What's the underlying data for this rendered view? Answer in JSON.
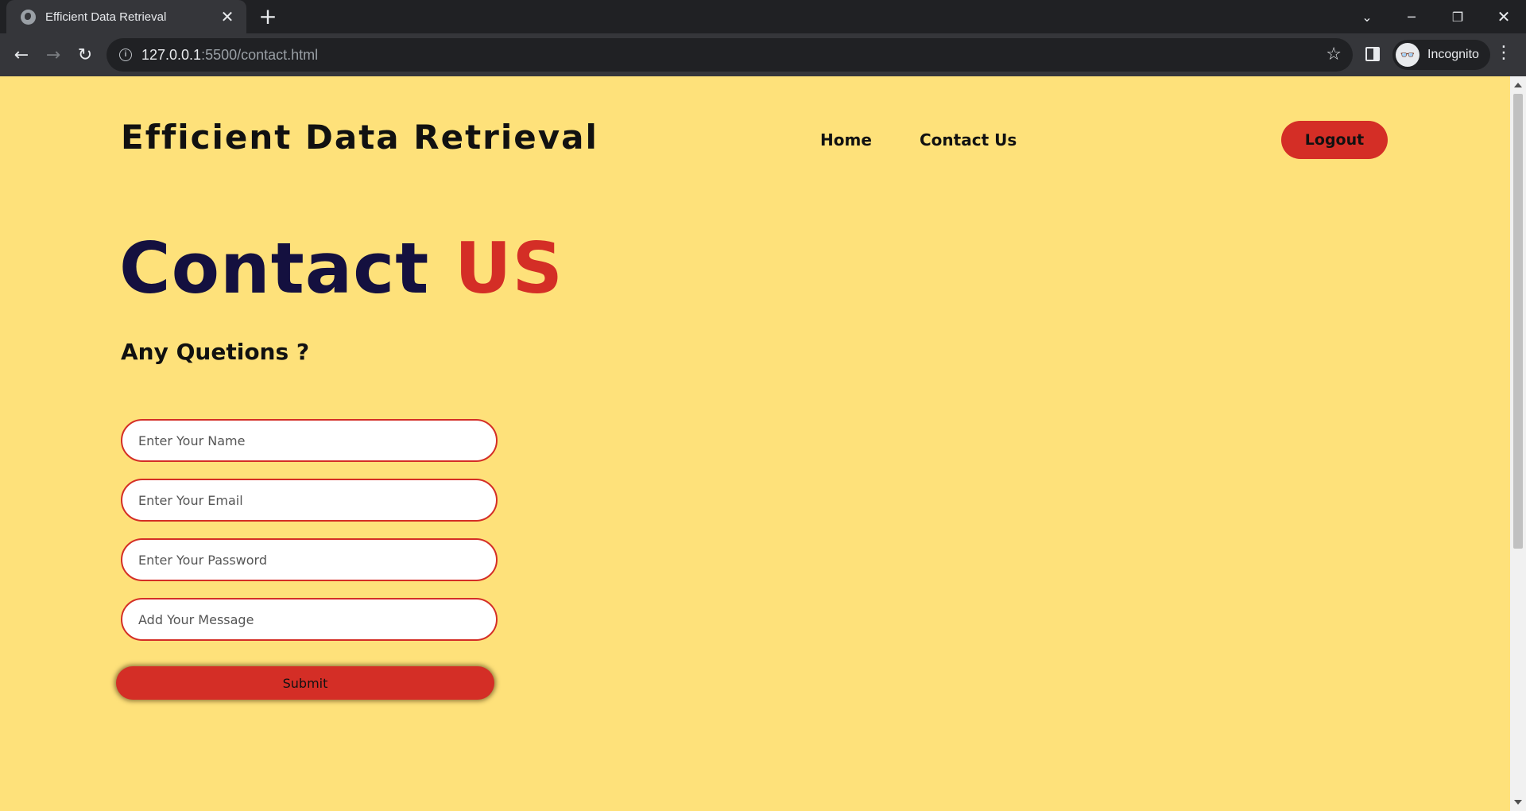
{
  "browser": {
    "tab_title": "Efficient Data Retrieval",
    "new_tab_symbol": "+",
    "url_host": "127.0.0.1",
    "url_rest": ":5500/contact.html",
    "profile_label": "Incognito",
    "icons": [
      "globe-icon",
      "close-icon",
      "back-icon",
      "forward-icon",
      "reload-icon",
      "info-icon",
      "star-icon",
      "side-panel-icon",
      "incognito-icon",
      "kebab-menu-icon",
      "tab-search-icon",
      "minimize-icon",
      "restore-icon",
      "window-close-icon"
    ]
  },
  "header": {
    "brand": "Efficient Data Retrieval",
    "nav": [
      {
        "label": "Home"
      },
      {
        "label": "Contact Us"
      }
    ],
    "logout_label": "Logout"
  },
  "main": {
    "title_part1": "Contact",
    "title_part2": "US",
    "subtitle": "Any Quetions ?",
    "form": {
      "name_placeholder": "Enter Your Name",
      "email_placeholder": "Enter Your Email",
      "password_placeholder": "Enter Your Password",
      "message_placeholder": "Add Your Message",
      "submit_label": "Submit"
    }
  },
  "colors": {
    "page_background": "#fee17a",
    "accent_red": "#d42e26",
    "title_navy": "#14103f",
    "browser_dark": "#202124"
  }
}
